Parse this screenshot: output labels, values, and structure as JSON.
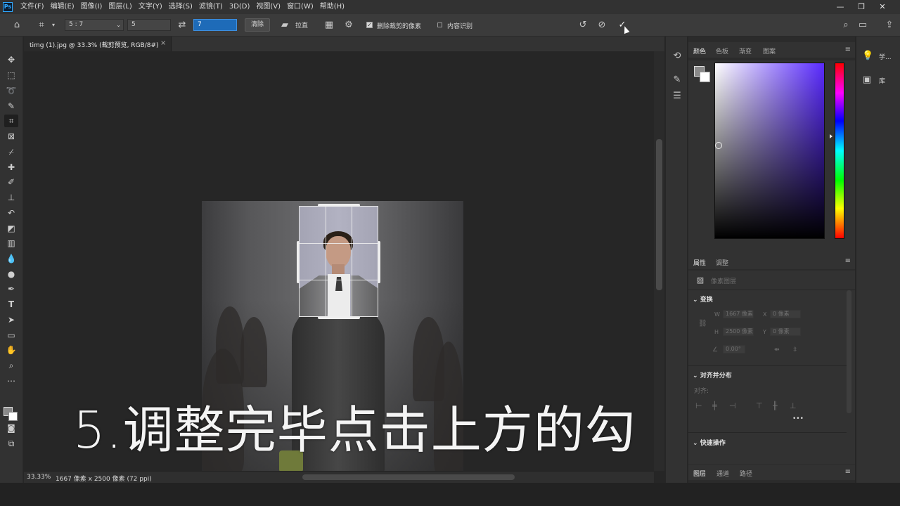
{
  "app": {
    "logo": "Ps"
  },
  "menu": [
    "文件(F)",
    "编辑(E)",
    "图像(I)",
    "图层(L)",
    "文字(Y)",
    "选择(S)",
    "滤镜(T)",
    "3D(D)",
    "视图(V)",
    "窗口(W)",
    "帮助(H)"
  ],
  "window_controls": {
    "minimize": "—",
    "restore": "❐",
    "close": "✕"
  },
  "options": {
    "ratio": "5 : 7",
    "width_value": "5",
    "height_value": "7",
    "clear_label": "清除",
    "straighten_label": "拉直",
    "delete_pixels_label": "删除裁剪的像素",
    "delete_pixels_checked": true,
    "content_aware_label": "内容识别",
    "content_aware_checked": false
  },
  "document": {
    "tab_title": "timg (1).jpg @ 33.3% (裁剪预览, RGB/8#)",
    "tab_close": "×",
    "zoom": "33.33%",
    "info": "1667 像素 x 2500 像素 (72 ppi)",
    "caption": "5.调整完毕点击上方的勾"
  },
  "color_panel": {
    "tabs": [
      "颜色",
      "色板",
      "渐变",
      "图案"
    ],
    "active_tab": 0,
    "hue_color": "#5a2bff"
  },
  "properties_panel": {
    "tabs": [
      "属性",
      "调整"
    ],
    "active_tab": 0,
    "layer_type": "像素图层",
    "transform_title": "变换",
    "w_label": "W",
    "w_value": "1667 像素",
    "h_label": "H",
    "h_value": "2500 像素",
    "x_label": "X",
    "x_value": "0 像素",
    "y_label": "Y",
    "y_value": "0 像素",
    "angle_value": "0.00°",
    "align_title": "对齐并分布",
    "align_label": "对齐:",
    "more": "•••",
    "quick_actions_title": "快速操作"
  },
  "layers_panel": {
    "tabs": [
      "图层",
      "通道",
      "路径"
    ],
    "active_tab": 0
  },
  "far_panel": {
    "learn_label": "学...",
    "library_label": "库"
  }
}
